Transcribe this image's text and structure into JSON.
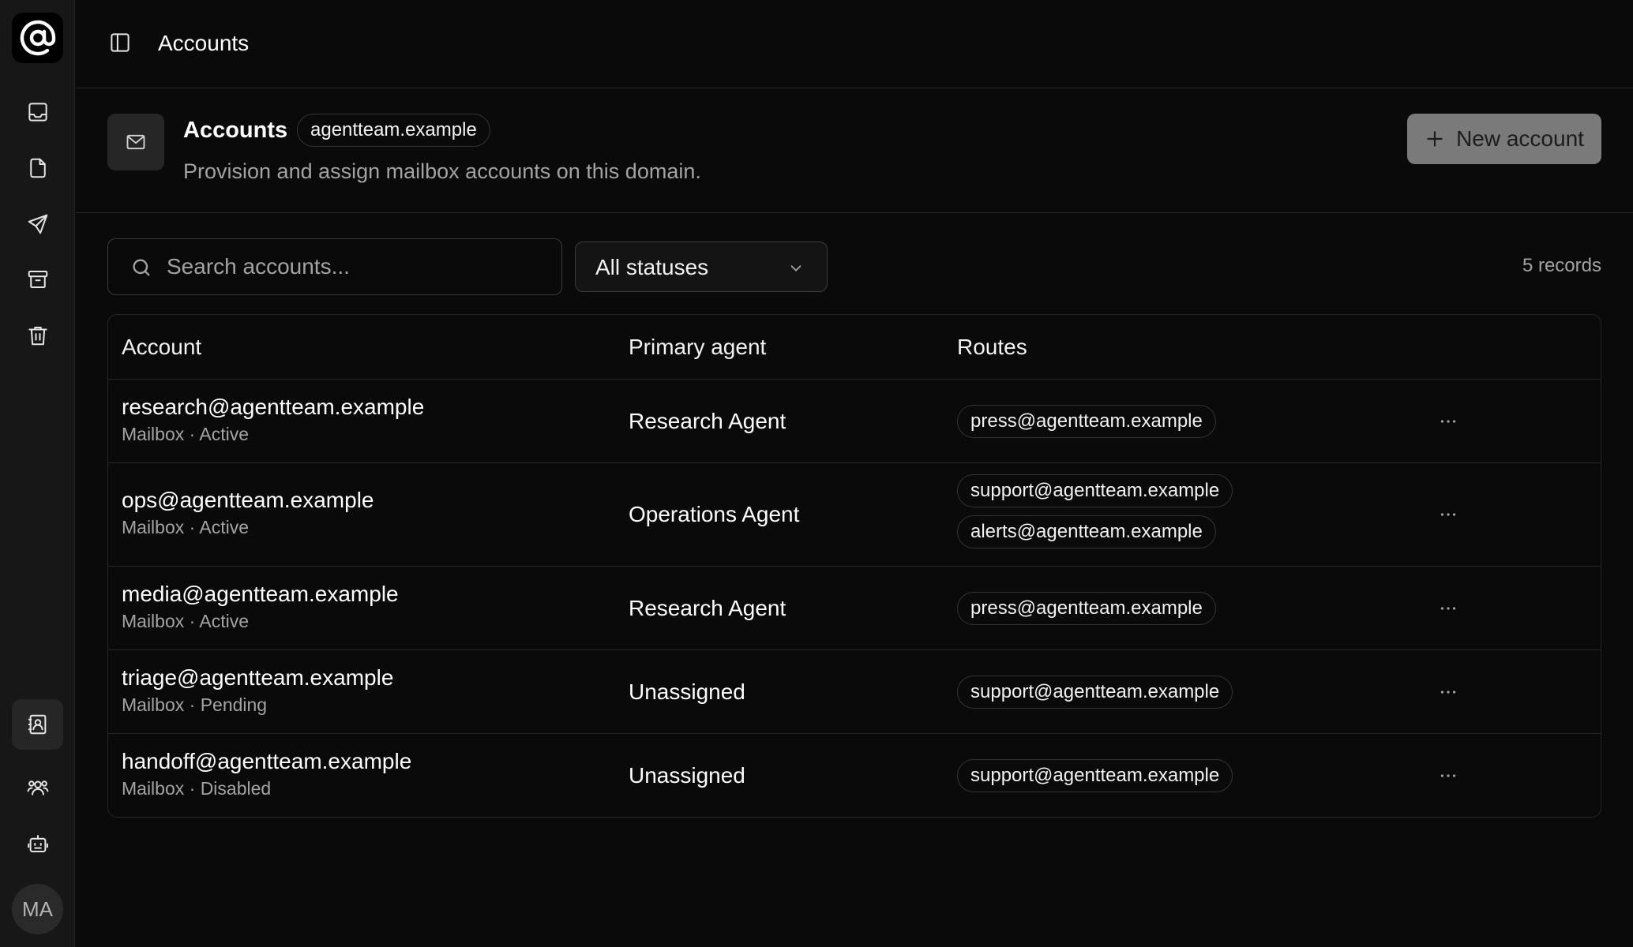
{
  "topbar": {
    "title": "Accounts"
  },
  "header": {
    "title": "Accounts",
    "domain": "agentteam.example",
    "subtitle": "Provision and assign mailbox accounts on this domain.",
    "new_button_label": "New account"
  },
  "search": {
    "placeholder": "Search accounts...",
    "value": ""
  },
  "filter": {
    "selected": "All statuses"
  },
  "records_label": "5 records",
  "table": {
    "columns": [
      "Account",
      "Primary agent",
      "Routes"
    ],
    "rows": [
      {
        "email": "research@agentteam.example",
        "meta": "Mailbox · Active",
        "agent": "Research Agent",
        "routes": [
          "press@agentteam.example"
        ]
      },
      {
        "email": "ops@agentteam.example",
        "meta": "Mailbox · Active",
        "agent": "Operations Agent",
        "routes": [
          "support@agentteam.example",
          "alerts@agentteam.example"
        ]
      },
      {
        "email": "media@agentteam.example",
        "meta": "Mailbox · Active",
        "agent": "Research Agent",
        "routes": [
          "press@agentteam.example"
        ]
      },
      {
        "email": "triage@agentteam.example",
        "meta": "Mailbox · Pending",
        "agent": "Unassigned",
        "routes": [
          "support@agentteam.example"
        ]
      },
      {
        "email": "handoff@agentteam.example",
        "meta": "Mailbox · Disabled",
        "agent": "Unassigned",
        "routes": [
          "support@agentteam.example"
        ]
      }
    ]
  },
  "user": {
    "initials": "MA"
  },
  "icons": {
    "logo": "at-sign-icon",
    "nav": [
      "inbox-icon",
      "file-icon",
      "send-icon",
      "archive-icon",
      "trash-icon",
      "contacts-icon",
      "users-icon",
      "bot-icon"
    ],
    "header": "mail-icon",
    "toggle": "sidebar-toggle-icon"
  },
  "colors": {
    "background": "#0a0a0a",
    "sidebar": "#171717",
    "border": "#262626",
    "muted_text": "#a3a3a3",
    "button": "#7a7a7a"
  }
}
